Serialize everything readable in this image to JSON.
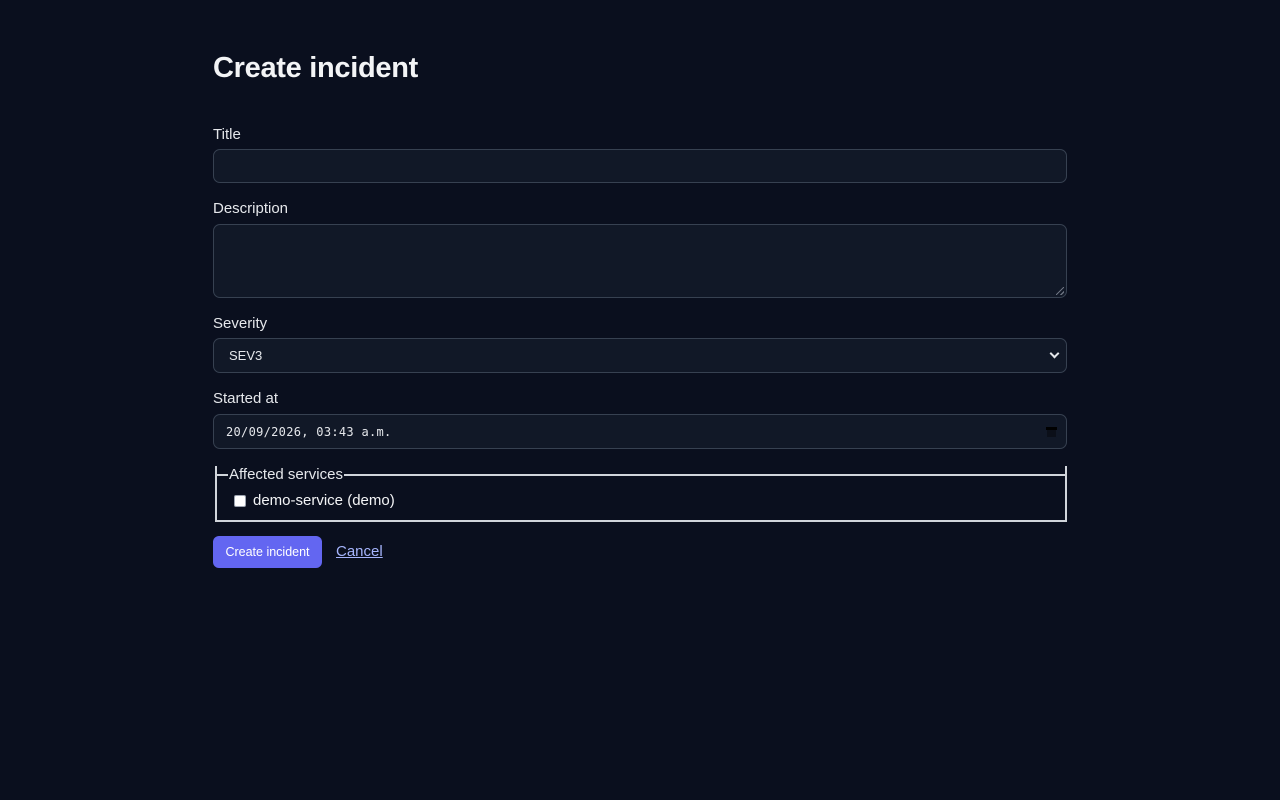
{
  "page": {
    "title": "Create incident"
  },
  "form": {
    "title": {
      "label": "Title",
      "value": "",
      "placeholder": ""
    },
    "description": {
      "label": "Description",
      "value": "",
      "placeholder": ""
    },
    "severity": {
      "label": "Severity",
      "selected": "SEV3"
    },
    "started_at": {
      "label": "Started at",
      "value": "20/09/2026, 03:43 a.m."
    },
    "affected_services": {
      "legend": "Affected services",
      "options": [
        {
          "label": "demo-service (demo)",
          "checked": false
        }
      ]
    },
    "actions": {
      "submit_label": "Create incident",
      "cancel_label": "Cancel"
    }
  },
  "colors": {
    "background": "#0a0f1e",
    "input_background": "#111827",
    "input_border": "#374151",
    "primary": "#6366f1",
    "link": "#a5b4fc"
  },
  "icons": {
    "select": "chevron-down-icon",
    "datetime": "calendar-icon"
  }
}
